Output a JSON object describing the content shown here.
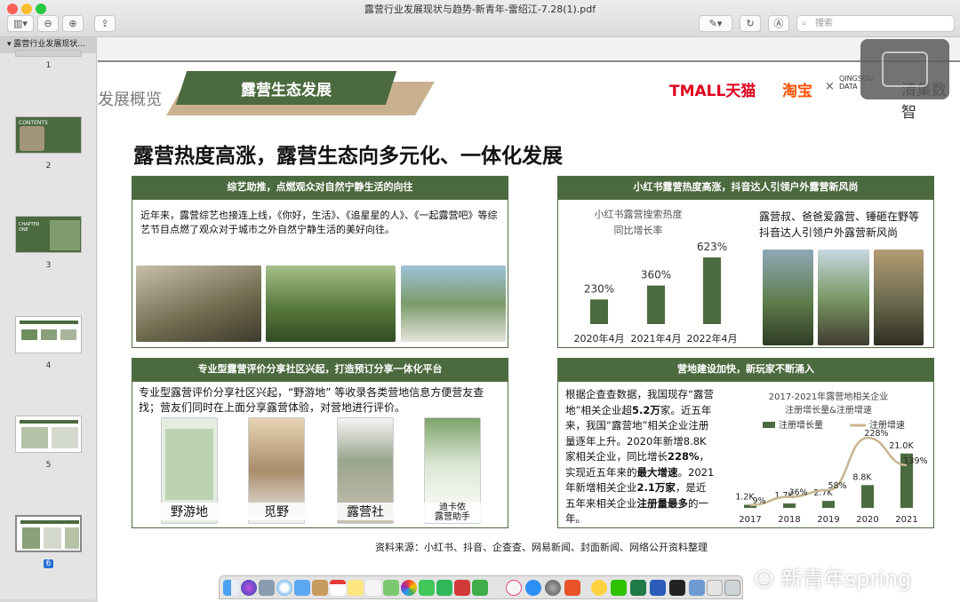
{
  "window": {
    "title": "露营行业发展现状与趋势-新青年-雷绍江-7.28(1).pdf",
    "search_placeholder": "搜索"
  },
  "sidebar": {
    "doc_title": "露营行业发展现状...",
    "thumbs": [
      {
        "num": "1"
      },
      {
        "num": "2",
        "text": "CONTENTS"
      },
      {
        "num": "3",
        "text": "CHAPTER ONE"
      },
      {
        "num": "4"
      },
      {
        "num": "5"
      },
      {
        "num": "6"
      }
    ]
  },
  "slide": {
    "section_label": "发展概览",
    "banner_title": "露营生态发展",
    "brand_tmall": "TMALL天猫",
    "brand_taobao": "淘宝",
    "brand_cross": "×",
    "brand_qingsou": "QINGSOU DATA",
    "brand_qingsou_cn": "清集数智",
    "headline": "露营热度高涨，露营生态向多元化、一体化发展",
    "panel1": {
      "header": "综艺助推，点燃观众对自然宁静生活的向往",
      "body": "近年来，露营综艺也接连上线，《你好，生活》、《追星星的人》、《一起露营吧》等综艺节目点燃了观众对于城市之外自然宁静生活的美好向往。"
    },
    "panel2": {
      "header": "小红书露营热度高涨，抖音达人引领户外露营新风尚",
      "right_text": "露营叔、爸爸爱露营、锤砸在野等抖音达人引领户外露营新风尚"
    },
    "panel3": {
      "header": "专业型露营评价分享社区兴起，打造预订分享一体化平台",
      "body": "专业型露营评价分享社区兴起，“野游地” 等收录各类营地信息方便营友查找；营友们同时在上面分享露营体验，对营地进行评价。",
      "apps": [
        "野游地",
        "觅野",
        "露营社",
        "迪卡侬\n露营助手"
      ]
    },
    "panel4": {
      "header": "营地建设加快，新玩家不断涌入",
      "body_parts": [
        {
          "t": "根据企查查数据，我国现存“露营地”相关企业超",
          "b": false
        },
        {
          "t": "5.2万",
          "b": true
        },
        {
          "t": "家。近五年来，我国“露营地”相关企业注册量逐年上升。2020年新增8.8K家相关企业，同比增长",
          "b": false
        },
        {
          "t": "228%",
          "b": true
        },
        {
          "t": "，实现近五年来的",
          "b": false
        },
        {
          "t": "最大增速",
          "b": true
        },
        {
          "t": "。2021年新增相关企业",
          "b": false
        },
        {
          "t": "2.1万家",
          "b": true
        },
        {
          "t": "，是近五年来相关企业",
          "b": false
        },
        {
          "t": "注册量最多",
          "b": true
        },
        {
          "t": "的一年。",
          "b": false
        }
      ]
    },
    "source": "资料来源：小红书、抖音、企查查、网易新闻、封面新闻、网络公开资料整理",
    "watermark": "新青年spring"
  },
  "chart_data": [
    {
      "type": "bar",
      "title": "小红书露营搜索热度\n同比增长率",
      "categories": [
        "2020年4月",
        "2021年4月",
        "2022年4月"
      ],
      "values": [
        230,
        360,
        623
      ],
      "value_labels": [
        "230%",
        "360%",
        "623%"
      ],
      "ylim": [
        0,
        680
      ],
      "color": "#4c6a3f"
    },
    {
      "type": "bar",
      "title": "2017-2021年露营地相关企业注册增长量&注册增速",
      "categories": [
        "2017",
        "2018",
        "2019",
        "2020",
        "2021"
      ],
      "series": [
        {
          "name": "注册增长量",
          "values": [
            1.2,
            1.7,
            2.7,
            8.8,
            21.0
          ],
          "labels": [
            "1.2K",
            "1.7K",
            "2.7K",
            "8.8K",
            "21.0K"
          ],
          "color": "#4c6a3f"
        },
        {
          "name": "注册增速",
          "values": [
            9,
            36,
            58,
            228,
            139
          ],
          "labels": [
            "9%",
            "36%",
            "58%",
            "228%",
            "139%"
          ],
          "color": "#c8b58f"
        }
      ],
      "ylim": [
        0,
        24
      ],
      "y2lim": [
        0,
        260
      ]
    }
  ]
}
